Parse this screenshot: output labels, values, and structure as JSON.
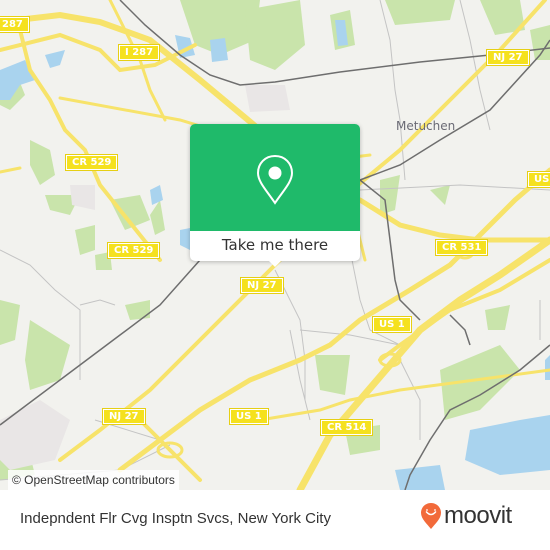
{
  "map": {
    "place_labels": [
      {
        "id": "metuchen",
        "text": "Metuchen"
      }
    ],
    "road_shields": [
      {
        "id": "i287-top",
        "text": "I 287"
      },
      {
        "id": "i287-left-edge",
        "text": "287"
      },
      {
        "id": "nj27-top-right",
        "text": "NJ 27"
      },
      {
        "id": "cr529-upper",
        "text": "CR 529"
      },
      {
        "id": "cr529-lower",
        "text": "CR 529"
      },
      {
        "id": "nj27-center",
        "text": "NJ 27"
      },
      {
        "id": "us1-right-edge",
        "text": "US"
      },
      {
        "id": "cr531",
        "text": "CR 531"
      },
      {
        "id": "us1-center",
        "text": "US 1"
      },
      {
        "id": "nj27-lower-left",
        "text": "NJ 27"
      },
      {
        "id": "us1-lower",
        "text": "US 1"
      },
      {
        "id": "cr514",
        "text": "CR 514"
      }
    ],
    "colors": {
      "land": "#f2f2ee",
      "park": "#c9e4ab",
      "water": "#a9d3ee",
      "road": "#f7e36a",
      "rail": "#6e6e6e"
    }
  },
  "popup": {
    "icon": "location-pin-icon",
    "cta_label": "Take me there",
    "accent": "#1fba6a"
  },
  "attribution": "© OpenStreetMap contributors",
  "footer": {
    "title": "Indepndent Flr Cvg Insptn Svcs, New York City",
    "logo_text": "moovit",
    "logo_color": "#f26a3a"
  }
}
